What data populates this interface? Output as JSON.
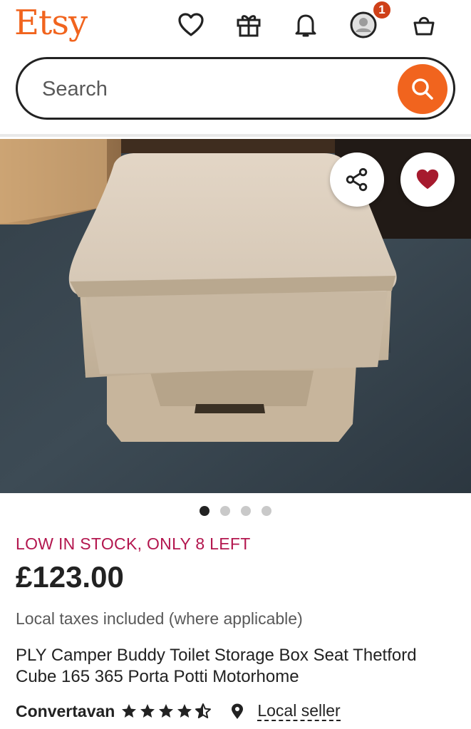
{
  "header": {
    "logo": "Etsy",
    "icons": [
      "heart-icon",
      "gift-icon",
      "bell-icon",
      "avatar-icon",
      "basket-icon"
    ],
    "notification_count": "1"
  },
  "search": {
    "placeholder": "Search"
  },
  "listing": {
    "photo_count": 4,
    "active_photo": 1,
    "stock_notice": "LOW IN STOCK, ONLY 8 LEFT",
    "price": "£123.00",
    "tax_note": "Local taxes included (where applicable)",
    "title": "PLY Camper Buddy Toilet Storage Box Seat Thetford Cube 165 365 Porta Potti Motorhome",
    "shop_name": "Convertavan",
    "rating": 4.5,
    "seller_type": "Local seller"
  },
  "colors": {
    "brand": "#F1641E",
    "stock_notice": "#B3164E",
    "favorite": "#A61A2E",
    "badge": "#CF4018"
  }
}
